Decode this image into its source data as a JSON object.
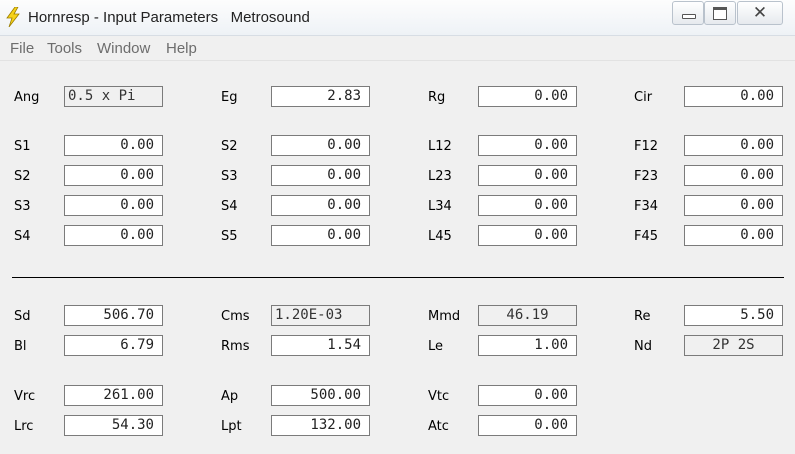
{
  "window": {
    "title": "Hornresp - Input Parameters   Metrosound",
    "icon": "lightning-bolt-icon",
    "close_glyph": "✕"
  },
  "menu": [
    "File",
    "Tools",
    "Window",
    "Help"
  ],
  "params": {
    "Ang": "0.5 x Pi",
    "Eg": "2.83",
    "Rg": "0.00",
    "Cir": "0.00",
    "S1": "0.00",
    "S2a": "0.00",
    "L12": "0.00",
    "F12": "0.00",
    "S2": "0.00",
    "S3a": "0.00",
    "L23": "0.00",
    "F23": "0.00",
    "S3": "0.00",
    "S4a": "0.00",
    "L34": "0.00",
    "F34": "0.00",
    "S4": "0.00",
    "S5": "0.00",
    "L45": "0.00",
    "F45": "0.00",
    "Sd": "506.70",
    "Cms": "1.20E-03",
    "Mmd": "46.19",
    "Re": "5.50",
    "Bl": "6.79",
    "Rms": "1.54",
    "Le": "1.00",
    "Nd": "2P 2S",
    "Vrc": "261.00",
    "Ap": "500.00",
    "Vtc": "0.00",
    "Lrc": "54.30",
    "Lpt": "132.00",
    "Atc": "0.00"
  },
  "labels": {
    "Ang": "Ang",
    "Eg": "Eg",
    "Rg": "Rg",
    "Cir": "Cir",
    "S1": "S1",
    "S2a": "S2",
    "L12": "L12",
    "F12": "F12",
    "S2": "S2",
    "S3a": "S3",
    "L23": "L23",
    "F23": "F23",
    "S3": "S3",
    "S4a": "S4",
    "L34": "L34",
    "F34": "F34",
    "S4": "S4",
    "S5": "S5",
    "L45": "L45",
    "F45": "F45",
    "Sd": "Sd",
    "Cms": "Cms",
    "Mmd": "Mmd",
    "Re": "Re",
    "Bl": "Bl",
    "Rms": "Rms",
    "Le": "Le",
    "Nd": "Nd",
    "Vrc": "Vrc",
    "Ap": "Ap",
    "Vtc": "Vtc",
    "Lrc": "Lrc",
    "Lpt": "Lpt",
    "Atc": "Atc"
  }
}
